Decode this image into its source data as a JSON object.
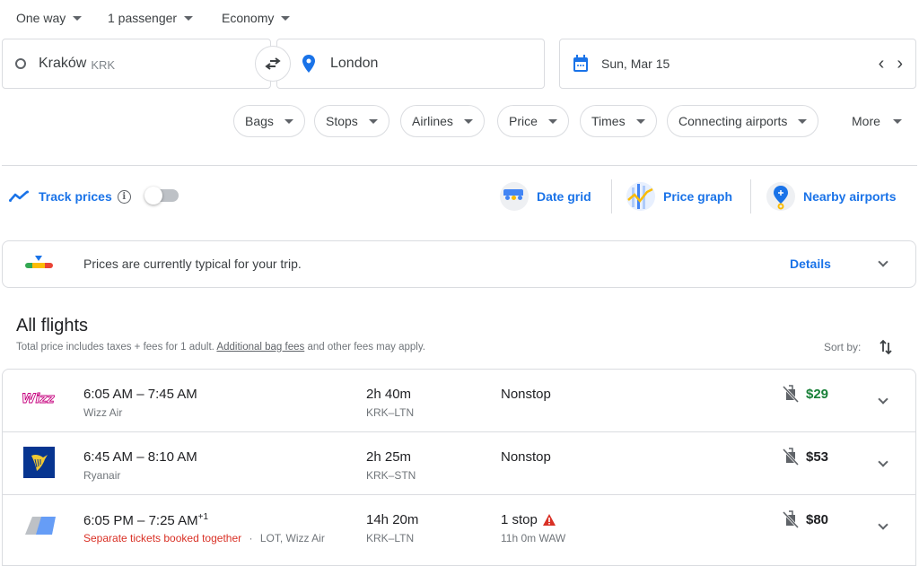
{
  "trip_options": {
    "trip_type": "One way",
    "passengers": "1 passenger",
    "cabin": "Economy"
  },
  "search": {
    "origin": "Kraków",
    "origin_code": "KRK",
    "destination": "London",
    "date": "Sun, Mar 15",
    "prev_date": "‹",
    "next_date": "›"
  },
  "filters": [
    "Bags",
    "Stops",
    "Airlines",
    "Price",
    "Times",
    "Connecting airports",
    "More"
  ],
  "tools": {
    "track_prices": "Track prices",
    "track_prices_enabled": false,
    "date_grid": "Date grid",
    "price_graph": "Price graph",
    "nearby_airports": "Nearby airports"
  },
  "insight": {
    "text": "Prices are currently typical for your trip.",
    "details": "Details"
  },
  "results": {
    "title": "All flights",
    "subtitle_pre": "Total price includes taxes + fees for 1 adult. ",
    "subtitle_link": "Additional bag fees",
    "subtitle_post": " and other fees may apply.",
    "sort_by": "Sort by:",
    "flights": [
      {
        "airline_logo": "wizz-air-logo",
        "depart": "6:05 AM",
        "arrive": "7:45 AM",
        "day_offset": "",
        "airline": "Wizz Air",
        "warning": "",
        "duration": "2h 40m",
        "route": "KRK–LTN",
        "stops": "Nonstop",
        "stop_detail": "",
        "price": "$29",
        "price_highlight": true
      },
      {
        "airline_logo": "ryanair-logo",
        "depart": "6:45 AM",
        "arrive": "8:10 AM",
        "day_offset": "",
        "airline": "Ryanair",
        "warning": "",
        "duration": "2h 25m",
        "route": "KRK–STN",
        "stops": "Nonstop",
        "stop_detail": "",
        "price": "$53",
        "price_highlight": false
      },
      {
        "airline_logo": "multi-airline-logo",
        "depart": "6:05 PM",
        "arrive": "7:25 AM",
        "day_offset": "+1",
        "airline": "LOT, Wizz Air",
        "warning": "Separate tickets booked together",
        "duration": "14h 20m",
        "route": "KRK–LTN",
        "stops": "1 stop",
        "stop_detail": "11h 0m WAW",
        "price": "$80",
        "price_highlight": false
      }
    ]
  },
  "colors": {
    "accent": "#1a73e8",
    "price_low": "#188038",
    "warning": "#d93025"
  }
}
